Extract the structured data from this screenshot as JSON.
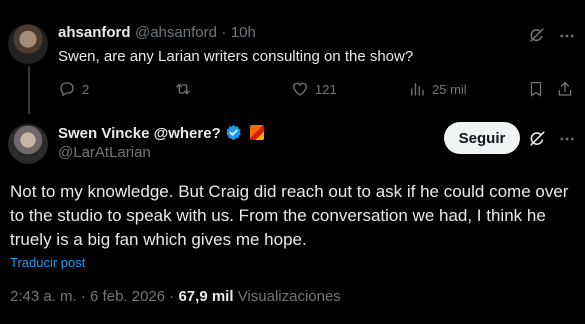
{
  "reply": {
    "author_name": "ahsanford",
    "author_handle": "@ahsanford",
    "separator": "·",
    "time": "10h",
    "text": "Swen, are any Larian writers consulting on the show?",
    "actions": {
      "replies": "2",
      "reposts": "",
      "likes": "121",
      "views": "25 mil"
    }
  },
  "tweet": {
    "author_name": "Swen Vincke @where?",
    "author_handle": "@LarAtLarian",
    "follow_label": "Seguir",
    "text": "Not to my knowledge. But Craig did reach out to ask if he could come over to the studio to speak with us. From the conversation we had, I think he truely is a big fan which gives me hope.",
    "translate_label": "Traducir post",
    "time": "2:43 a. m.",
    "date": "6 feb. 2026",
    "views_count": "67,9 mil",
    "views_label": "Visualizaciones"
  },
  "colors": {
    "background": "#000000",
    "text": "#e7e9ea",
    "muted": "#71767b",
    "accent": "#1d9bf0",
    "verified": "#1d9bf0"
  },
  "icons": [
    "grok-icon",
    "reply-icon",
    "repost-icon",
    "like-icon",
    "views-icon",
    "bookmark-icon",
    "share-icon",
    "verified-badge-icon",
    "flag-emoji-icon"
  ]
}
